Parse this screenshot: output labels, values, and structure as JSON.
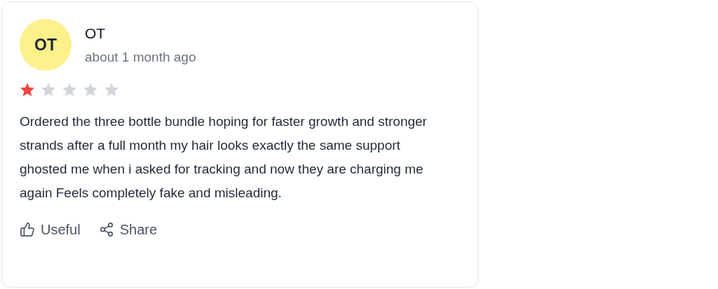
{
  "review": {
    "avatar_initials": "OT",
    "author": "OT",
    "time": "about 1 month ago",
    "stars": 1,
    "body": "Ordered the three bottle bundle hoping for faster growth and stronger strands after a full month my hair looks exactly the same support ghosted me when i asked for tracking and now they are charging me again Feels completely fake and misleading.",
    "actions": [
      {
        "kind": "useful",
        "label": "Useful"
      },
      {
        "kind": "share",
        "label": "Share"
      }
    ]
  }
}
